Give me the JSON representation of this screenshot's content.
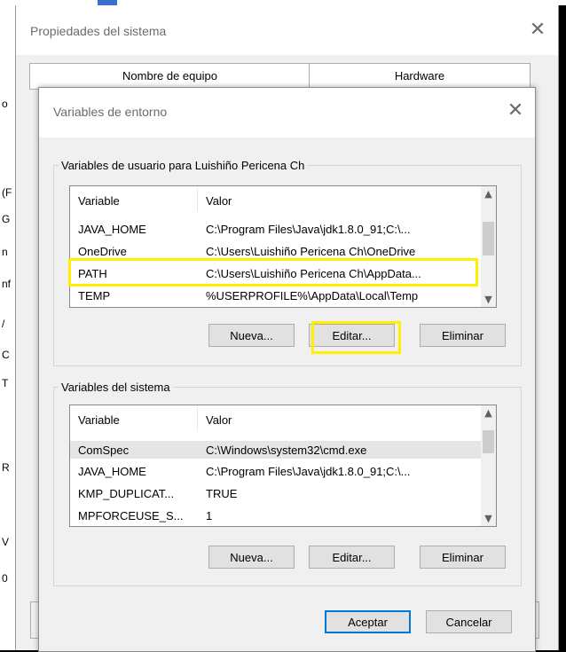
{
  "outer_window": {
    "title": "Propiedades del sistema",
    "tabs": [
      "Nombre de equipo",
      "Hardware"
    ]
  },
  "dialog": {
    "title": "Variables de entorno",
    "user_group": {
      "legend": "Variables de usuario para Luishiño Pericena Ch",
      "columns": [
        "Variable",
        "Valor"
      ],
      "rows": [
        {
          "variable": "JAVA_HOME",
          "value": "C:\\Program Files\\Java\\jdk1.8.0_91;C:\\..."
        },
        {
          "variable": "OneDrive",
          "value": "C:\\Users\\Luishiño Pericena Ch\\OneDrive"
        },
        {
          "variable": "PATH",
          "value": "C:\\Users\\Luishiño Pericena Ch\\AppData..."
        },
        {
          "variable": "TEMP",
          "value": "%USERPROFILE%\\AppData\\Local\\Temp"
        }
      ],
      "buttons": {
        "new": "Nueva...",
        "edit": "Editar...",
        "delete": "Eliminar"
      }
    },
    "system_group": {
      "legend": "Variables del sistema",
      "columns": [
        "Variable",
        "Valor"
      ],
      "rows": [
        {
          "variable": "ComSpec",
          "value": "C:\\Windows\\system32\\cmd.exe"
        },
        {
          "variable": "JAVA_HOME",
          "value": "C:\\Program Files\\Java\\jdk1.8.0_91;C:\\..."
        },
        {
          "variable": "KMP_DUPLICAT...",
          "value": "TRUE"
        },
        {
          "variable": "MPFORCEUSE_S...",
          "value": "1"
        }
      ],
      "buttons": {
        "new": "Nueva...",
        "edit": "Editar...",
        "delete": "Eliminar"
      }
    },
    "footer": {
      "ok": "Aceptar",
      "cancel": "Cancelar"
    }
  },
  "icons": {
    "close": "close-icon",
    "scroll_up": "chevron-up-icon",
    "scroll_down": "chevron-down-icon"
  },
  "colors": {
    "highlight": "#ffef00",
    "selected_row": "#e5e5e5",
    "focus_border": "#0078d7"
  },
  "background_window_fragments": [
    "o",
    "(F",
    "G",
    "n",
    "nf",
    "/",
    "C",
    "T",
    "R",
    "V",
    "0"
  ]
}
